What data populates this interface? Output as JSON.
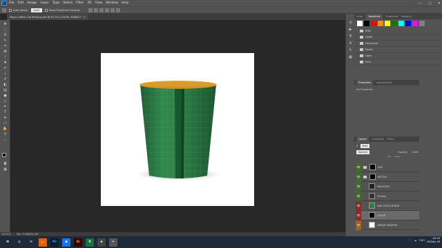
{
  "app": {
    "logo": "Ps"
  },
  "menu": [
    "File",
    "Edit",
    "Image",
    "Layer",
    "Type",
    "Select",
    "Filter",
    "3D",
    "View",
    "Window",
    "Help"
  ],
  "window_controls": [
    "—",
    "□",
    "✕"
  ],
  "options": {
    "auto_select": "Auto-Select:",
    "auto_select_value": "Layer",
    "transform": "Show Transform Controls"
  },
  "document": {
    "tab_title": "Paper Coffee Cup Mockup.psd @ 61.7% (COLOR, RGB/8) *",
    "close": "×"
  },
  "status": {
    "zoom": "61.67%",
    "doc_info": "Doc: 3.33M/91.2M"
  },
  "swatches_panel": {
    "tabs": [
      "Color",
      "Swatches",
      "Gradients",
      "Patterns"
    ],
    "active_tab": "Swatches",
    "colors": [
      "#ffffff",
      "#000000",
      "#ff0000",
      "#ff8c00",
      "#ffff00",
      "#008000",
      "#00ffff",
      "#0000ff",
      "#ff00ff",
      "#808080"
    ],
    "folders": [
      "RGB",
      "CMYK",
      "Grayscale",
      "Pastel",
      "Light",
      "Pure"
    ]
  },
  "properties_panel": {
    "tabs": [
      "Properties",
      "Adjustments"
    ],
    "active_tab": "Properties",
    "content": "No Properties"
  },
  "layers_panel": {
    "tabs": [
      "Layers",
      "Channels",
      "Paths"
    ],
    "active_tab": "Layers",
    "kind": "Kind",
    "blend": "Normal",
    "opacity_label": "Opacity:",
    "opacity": "100%",
    "fill_label": "Fill:",
    "fill": "100%",
    "layers": [
      {
        "name": "CAP",
        "folder": true
      },
      {
        "name": "BOTTLE",
        "folder": true
      },
      {
        "name": "HIGHLIGHT"
      },
      {
        "name": "Contour"
      },
      {
        "name": "ADD YOUR DESIGN"
      },
      {
        "name": "COLOR"
      },
      {
        "name": "LINEAR SHADOW"
      }
    ]
  },
  "taskbar": {
    "apps": [
      "⊞",
      "◎",
      "✉",
      "🦊",
      "Ps",
      "◉",
      "Ai",
      "X",
      "◈",
      "✦"
    ],
    "tray": [
      "^",
      "☁",
      "ENG"
    ],
    "time": "02:20",
    "date": "06-Dec-18"
  },
  "colors": {
    "cup_green": "#2f7d48",
    "cup_stripe": "#145a2c",
    "cup_rim": "#e0a235",
    "ps_blue": "#31a8ff"
  }
}
